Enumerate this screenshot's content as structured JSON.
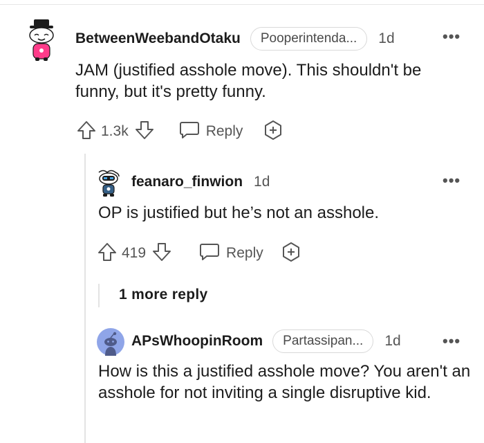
{
  "comments": [
    {
      "username": "BetweenWeebandOtaku",
      "flair": "Pooperintenda...",
      "time": "1d",
      "body": "JAM (justified asshole move). This shouldn't be funny, but it's pretty funny.",
      "votes": "1.3k",
      "reply_label": "Reply",
      "avatar_icon": "snoo-top-hat-avatar-icon"
    },
    {
      "username": "feanaro_finwion",
      "time": "1d",
      "body": "OP is justified but he’s not an asshole.",
      "votes": "419",
      "reply_label": "Reply",
      "avatar_icon": "snoo-robot-avatar-icon"
    },
    {
      "username": "APsWhoopinRoom",
      "flair": "Partassipan...",
      "time": "1d",
      "body": "How is this a justified asshole move? You aren't an asshole for not inviting a single disruptive kid.",
      "avatar_icon": "default-snoo-avatar-icon"
    }
  ],
  "more_replies_label": "1 more reply",
  "overflow_menu_glyph": "•••",
  "colors": {
    "text": "#1c1c1c",
    "muted": "#555555",
    "default_avatar_bg": "#8fa5e8"
  }
}
